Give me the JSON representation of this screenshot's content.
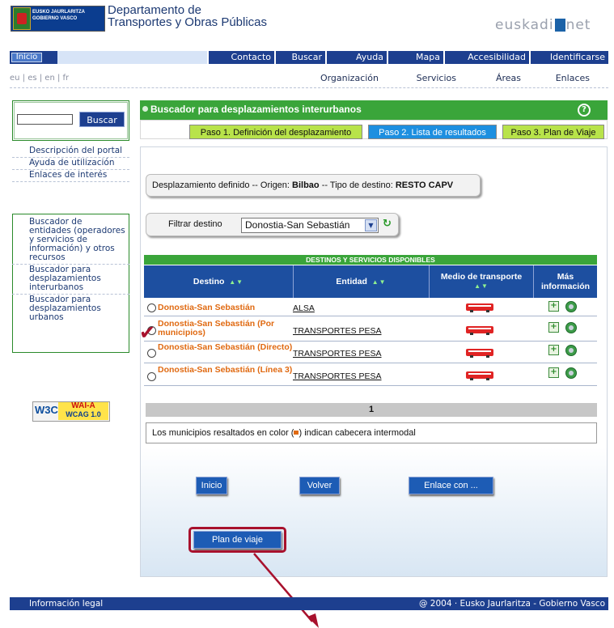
{
  "header": {
    "logo_text_1": "EUSKO JAURLARITZA",
    "logo_text_2": "GOBIERNO VASCO",
    "dept_line1": "Departamento de",
    "dept_line2": "Transportes y Obras Públicas",
    "brand": "euskadi",
    "brand_suffix": "net"
  },
  "nav": {
    "home": "Inicio",
    "items": [
      "Contacto",
      "Buscar",
      "Ayuda",
      "Mapa",
      "Accesibilidad",
      "Identificarse"
    ]
  },
  "langs": "eu | es | en | fr",
  "subnav": [
    "Organización",
    "Servicios",
    "Áreas",
    "Enlaces"
  ],
  "sidebar": {
    "search_button": "Buscar",
    "links": [
      "Descripción del portal",
      "Ayuda de utilización",
      "Enlaces de interés"
    ],
    "tools": [
      "Buscador de entidades (operadores y servicios de información) y otros recursos",
      "Buscador para desplazamientos interurbanos",
      "Buscador para desplazamientos urbanos"
    ],
    "wcag_w3c": "W3C",
    "wcag_level": "WAI-A",
    "wcag_version": "WCAG 1.0"
  },
  "main": {
    "title": "Buscador para desplazamientos interurbanos",
    "help": "?",
    "steps": [
      "Paso 1. Definición del desplazamiento",
      "Paso 2. Lista de resultados",
      "Paso 3. Plan de Viaje"
    ],
    "defined_prefix": "Desplazamiento definido -- Origen: ",
    "defined_origin": "Bilbao",
    "defined_mid": " -- Tipo de destino: ",
    "defined_type": "RESTO CAPV",
    "filter_label": "Filtrar destino",
    "filter_value": "Donostia-San Sebastián"
  },
  "table": {
    "title": "DESTINOS Y SERVICIOS DISPONIBLES",
    "col_dest": "Destino",
    "col_ent": "Entidad",
    "col_medio": "Medio de transporte",
    "col_mas_1": "Más",
    "col_mas_2": "información",
    "rows": [
      {
        "dest": "Donostia-San Sebastián",
        "ent": "ALSA"
      },
      {
        "dest": "Donostia-San Sebastián (Por municipios)",
        "ent": "TRANSPORTES PESA"
      },
      {
        "dest": "Donostia-San Sebastián (Directo)",
        "ent": "TRANSPORTES PESA"
      },
      {
        "dest": "Donostia-San Sebastián (Línea 3)",
        "ent": "TRANSPORTES PESA"
      }
    ],
    "page": "1",
    "note_pre": "Los municipios resaltados en color (",
    "note_post": ") indican cabecera intermodal"
  },
  "buttons": {
    "inicio": "Inicio",
    "volver": "Volver",
    "enlace": "Enlace con ...",
    "plan": "Plan de viaje"
  },
  "footer": {
    "left": "Información legal",
    "right": "@ 2004 · Eusko Jaurlaritza - Gobierno Vasco"
  },
  "colors": {
    "nav_blue": "#1d3f8f",
    "green": "#3aa53a",
    "orange": "#e06a12",
    "highlight": "#a8112d"
  }
}
